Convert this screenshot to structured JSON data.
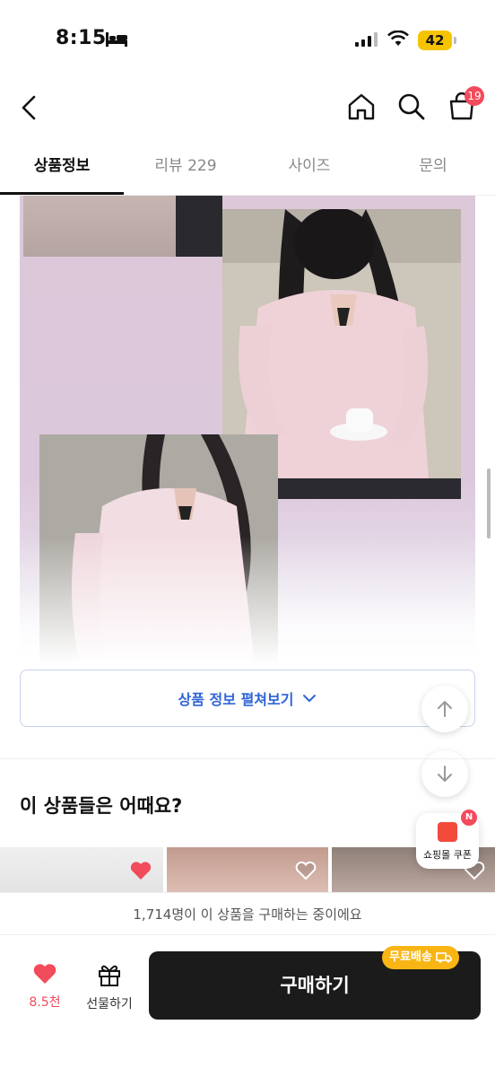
{
  "status_bar": {
    "time": "8:15",
    "battery": "42"
  },
  "header": {
    "cart_count": "19"
  },
  "tabs": [
    {
      "label": "상품정보"
    },
    {
      "label": "리뷰 229"
    },
    {
      "label": "사이즈"
    },
    {
      "label": "문의"
    }
  ],
  "detail": {
    "expand_label": "상품 정보 펼쳐보기"
  },
  "recommend": {
    "title": "이 상품들은 어때요?"
  },
  "coupon": {
    "label": "쇼핑몰 쿠폰",
    "badge": "N"
  },
  "purchase_notice": "1,714명이 이 상품을 구매하는 중이에요",
  "bottom": {
    "like_count": "8.5천",
    "gift_label": "선물하기",
    "buy_label": "구매하기",
    "free_shipping": "무료배송"
  },
  "colors": {
    "accent_blue": "#2f64d8",
    "like_red": "#f24b5b",
    "shipping_yellow": "#f8b514"
  }
}
